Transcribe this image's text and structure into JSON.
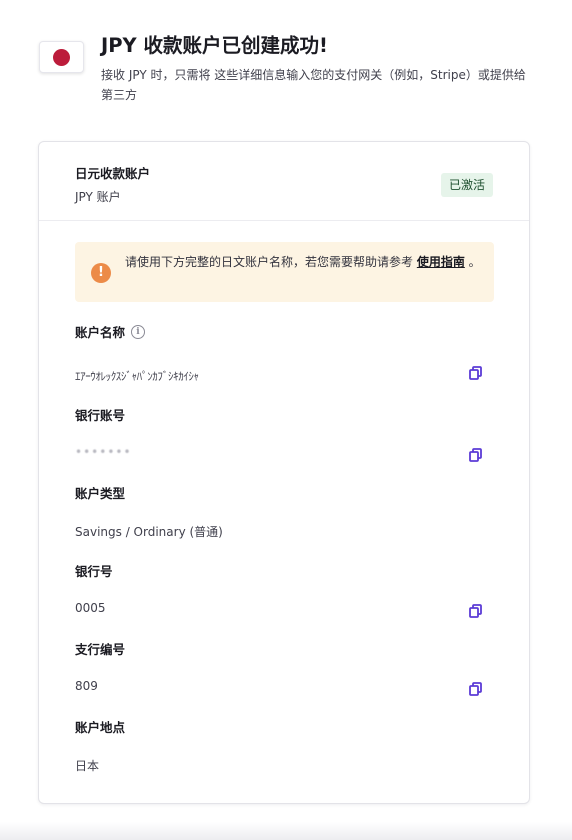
{
  "header": {
    "flag_icon": "japan-flag-icon",
    "title": "JPY 收款账户已创建成功!",
    "subtitle": "接收 JPY 时，只需将 这些详细信息输入您的支付网关（例如，Stripe）或提供给第三方"
  },
  "account": {
    "title": "日元收款账户",
    "subtitle": "JPY 账户",
    "status": "已激活"
  },
  "notice": {
    "text": "请使用下方完整的日文账户名称，若您需要帮助请参考 ",
    "link_text": "使用指南",
    "suffix": " 。"
  },
  "fields": [
    {
      "label": "账户名称",
      "value": "ｴｱｰｳｵﾚｯｸｽｼﾞｬﾊﾟﾝｶﾌﾞｼｷｶｲｼｬ",
      "copyable": true,
      "info": true
    },
    {
      "label": "银行账号",
      "value": "•••••••",
      "copyable": true
    },
    {
      "label": "账户类型",
      "value": "Savings / Ordinary (普通)",
      "copyable": false
    },
    {
      "label": "银行号",
      "value": "0005",
      "copyable": true
    },
    {
      "label": "支行编号",
      "value": "809",
      "copyable": true
    },
    {
      "label": "账户地点",
      "value": "日本",
      "copyable": false
    }
  ],
  "colors": {
    "accent": "#5b3bd6",
    "badge_bg": "#e6f4ea",
    "notice_bg": "#fdf4e3",
    "warning": "#ec8b48",
    "flag_red": "#bc1c3b"
  }
}
